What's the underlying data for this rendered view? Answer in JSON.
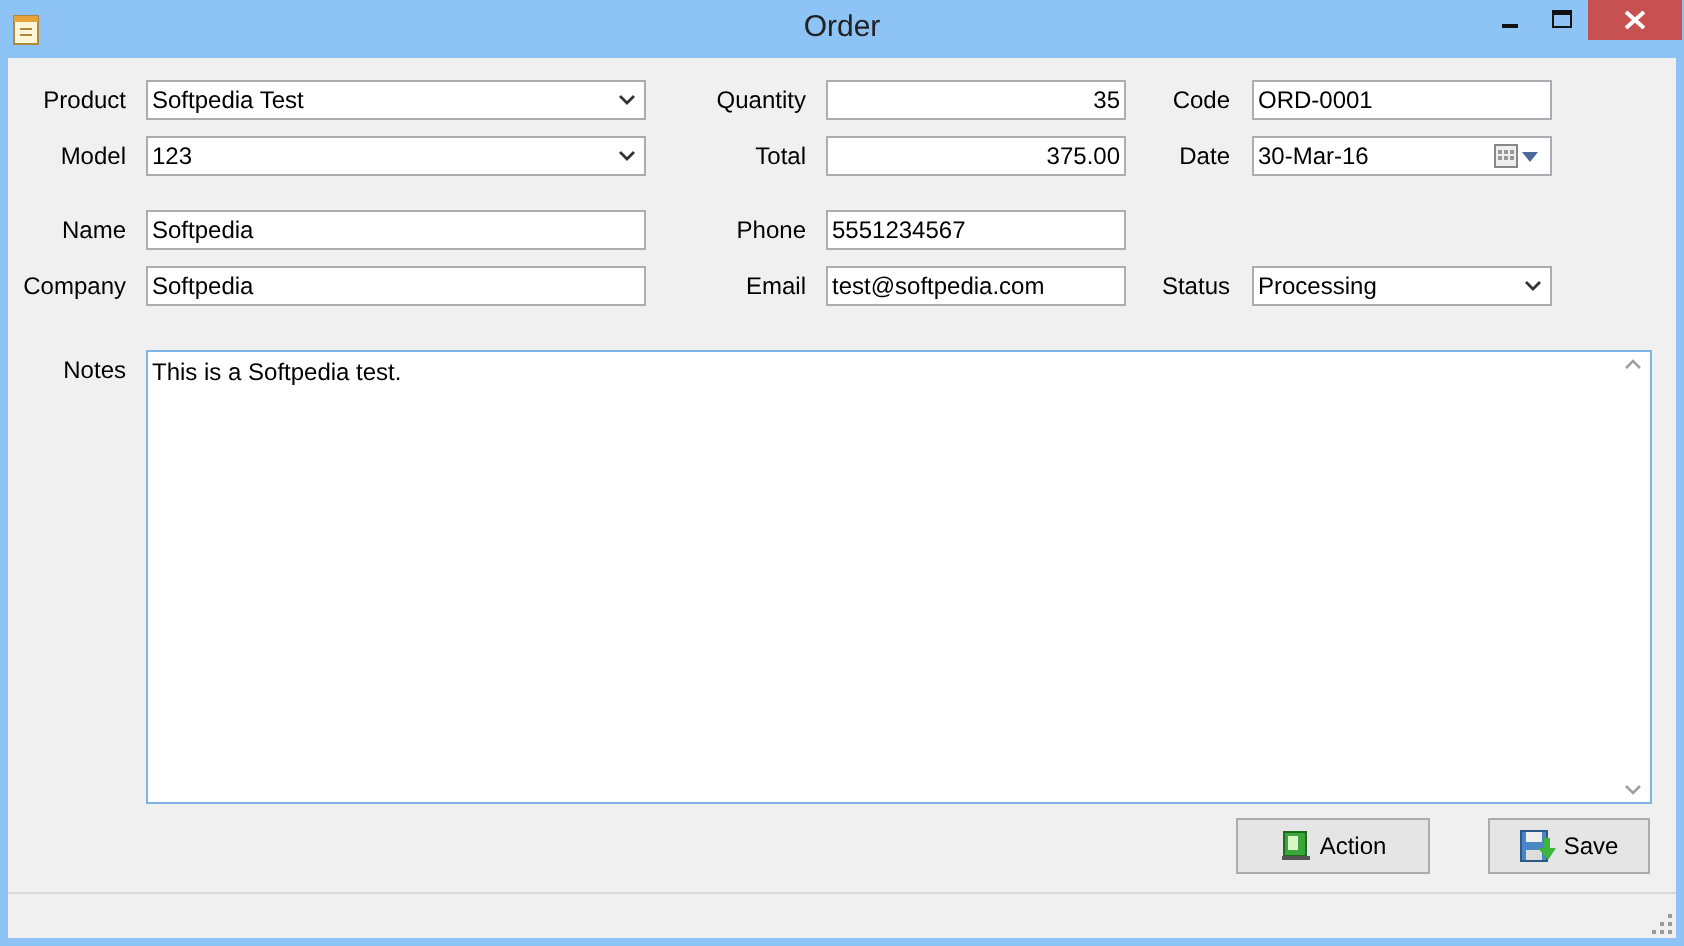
{
  "window": {
    "title": "Order"
  },
  "groups": [
    [
      {
        "cells": [
          {
            "label": "Product",
            "kind": "combo",
            "value": "Softpedia Test"
          },
          {
            "label": "Quantity",
            "kind": "number",
            "value": "35"
          },
          {
            "label": "Code",
            "kind": "text",
            "value": "ORD-0001"
          }
        ]
      },
      {
        "cells": [
          {
            "label": "Model",
            "kind": "combo",
            "value": "123"
          },
          {
            "label": "Total",
            "kind": "number",
            "value": "375.00"
          },
          {
            "label": "Date",
            "kind": "date",
            "value": "30-Mar-16"
          }
        ]
      }
    ],
    [
      {
        "cells": [
          {
            "label": "Name",
            "kind": "text",
            "value": "Softpedia"
          },
          {
            "label": "Phone",
            "kind": "text",
            "value": "5551234567"
          }
        ]
      },
      {
        "cells": [
          {
            "label": "Company",
            "kind": "text",
            "value": "Softpedia"
          },
          {
            "label": "Email",
            "kind": "text",
            "value": "test@softpedia.com"
          },
          {
            "label": "Status",
            "kind": "combo",
            "value": "Processing"
          }
        ]
      }
    ]
  ],
  "notes": {
    "label": "Notes",
    "value": "This is a Softpedia test."
  },
  "buttons": [
    {
      "label": "Action",
      "kind": "action"
    },
    {
      "label": "Save",
      "kind": "save"
    }
  ]
}
